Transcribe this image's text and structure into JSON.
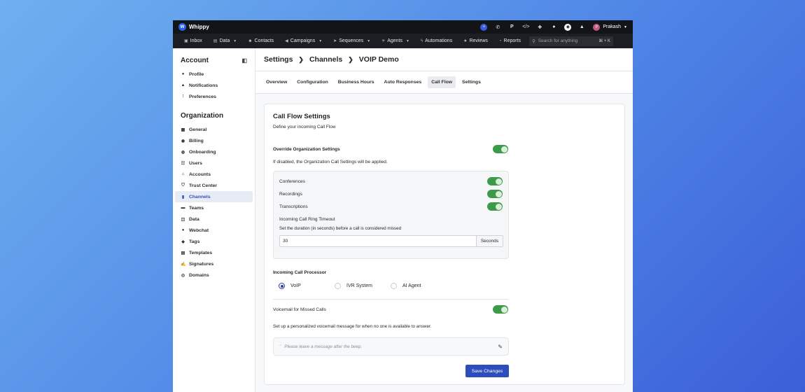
{
  "app": {
    "name": "Whippy",
    "logo_text": "W"
  },
  "topbar": {
    "icons": [
      "plus-icon",
      "phone-icon",
      "p-icon",
      "code-icon",
      "puzzle-icon",
      "help-circle-icon",
      "status-icon",
      "bell-icon"
    ],
    "p_label": "P",
    "user": {
      "initial": "P",
      "name": "Prakash"
    }
  },
  "nav": {
    "items": [
      {
        "label": "Inbox",
        "icon": "inbox-icon",
        "has_dropdown": false
      },
      {
        "label": "Data",
        "icon": "data-icon",
        "has_dropdown": true
      },
      {
        "label": "Contacts",
        "icon": "contacts-icon",
        "has_dropdown": false
      },
      {
        "label": "Campaigns",
        "icon": "megaphone-icon",
        "has_dropdown": true
      },
      {
        "label": "Sequences",
        "icon": "sequences-icon",
        "has_dropdown": true
      },
      {
        "label": "Agents",
        "icon": "agents-icon",
        "has_dropdown": true
      },
      {
        "label": "Automations",
        "icon": "bolt-icon",
        "has_dropdown": false
      },
      {
        "label": "Reviews",
        "icon": "star-icon",
        "has_dropdown": false
      },
      {
        "label": "Reports",
        "icon": "reports-icon",
        "has_dropdown": false
      }
    ],
    "search": {
      "placeholder": "Search for anything",
      "shortcut": "⌘ + K"
    }
  },
  "sidebar": {
    "account_title": "Account",
    "account_items": [
      {
        "label": "Profile",
        "icon": "user-icon"
      },
      {
        "label": "Notifications",
        "icon": "bell-icon"
      },
      {
        "label": "Preferences",
        "icon": "sliders-icon"
      }
    ],
    "org_title": "Organization",
    "org_items": [
      {
        "label": "General",
        "icon": "grid-icon"
      },
      {
        "label": "Billing",
        "icon": "billing-icon"
      },
      {
        "label": "Onboarding",
        "icon": "onboarding-icon"
      },
      {
        "label": "Users",
        "icon": "users-icon"
      },
      {
        "label": "Accounts",
        "icon": "accounts-icon"
      },
      {
        "label": "Trust Center",
        "icon": "shield-icon"
      },
      {
        "label": "Channels",
        "icon": "channels-icon",
        "active": true
      },
      {
        "label": "Teams",
        "icon": "teams-icon"
      },
      {
        "label": "Data",
        "icon": "database-icon"
      },
      {
        "label": "Webchat",
        "icon": "chat-icon"
      },
      {
        "label": "Tags",
        "icon": "tag-icon"
      },
      {
        "label": "Templates",
        "icon": "templates-icon"
      },
      {
        "label": "Signatures",
        "icon": "signature-icon"
      },
      {
        "label": "Domains",
        "icon": "globe-icon"
      }
    ]
  },
  "breadcrumb": {
    "first": "Settings",
    "second": "Channels",
    "third": "VOIP Demo"
  },
  "tabs": [
    {
      "label": "Overview"
    },
    {
      "label": "Configuration"
    },
    {
      "label": "Business Hours"
    },
    {
      "label": "Auto Responses"
    },
    {
      "label": "Call Flow",
      "active": true
    },
    {
      "label": "Settings"
    }
  ],
  "card": {
    "title": "Call Flow Settings",
    "subtitle": "Define your incoming Call Flow",
    "override_label": "Override Organization Settings",
    "override_enabled": true,
    "override_note": "If disabled, the Organization Call Settings will be applied.",
    "features": [
      {
        "label": "Conferences",
        "enabled": true
      },
      {
        "label": "Recordings",
        "enabled": true
      },
      {
        "label": "Transcriptions",
        "enabled": true
      }
    ],
    "ring_timeout": {
      "title": "Incoming Call Ring Timeout",
      "description": "Set the duration (in seconds) before a call is considered missed",
      "value": "30",
      "unit": "Seconds"
    },
    "processor": {
      "title": "Incoming Call Processor",
      "options": [
        "VoIP",
        "IVR System",
        "AI Agent"
      ],
      "selected": "VoIP"
    },
    "voicemail": {
      "label": "Voicemail for Missed Calls",
      "enabled": true,
      "description": "Set up a personalized voicemail message for when no one is available to answer.",
      "message": "Please leave a message after the beep."
    },
    "save_label": "Save Changes"
  },
  "colors": {
    "accent": "#2d4dbd",
    "toggle_on": "#3d9a4b",
    "topbar": "#121417"
  }
}
